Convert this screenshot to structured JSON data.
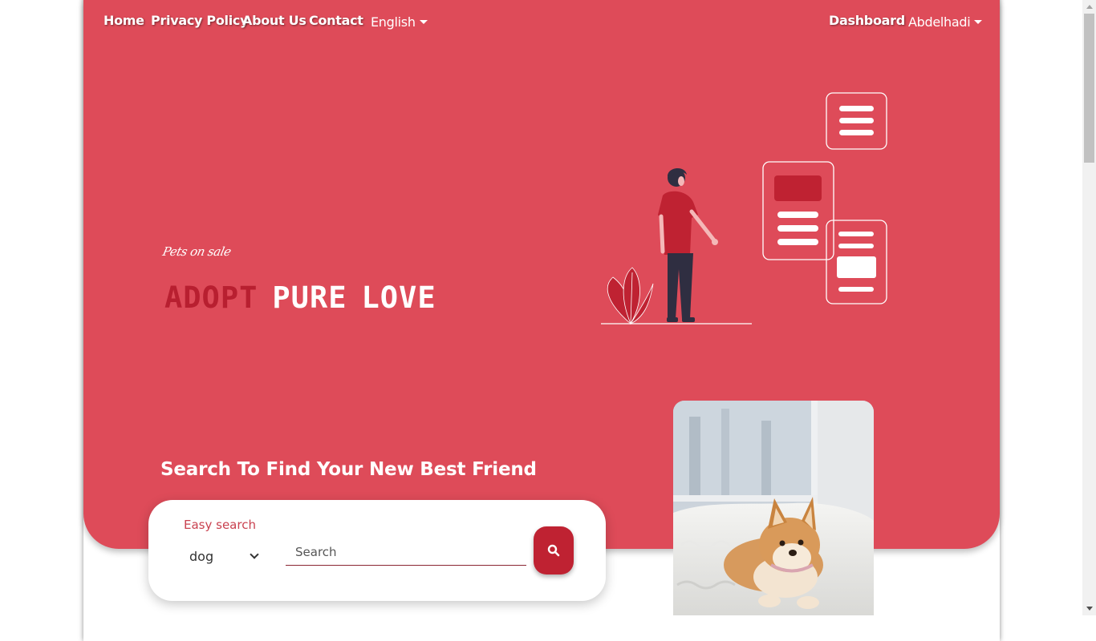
{
  "nav": {
    "left_links": [
      "Home",
      "Privacy Policy",
      "About Us",
      "Contact"
    ],
    "language": "English",
    "dashboard": "Dashboard",
    "user": "Abdelhadi"
  },
  "hero": {
    "tagline": "Pets on sale",
    "headline": [
      "ADOPT",
      "PURE",
      "LOVE"
    ],
    "search_heading": "Search To Find Your New Best Friend"
  },
  "search": {
    "label": "Easy search",
    "selected_animal": "dog",
    "placeholder": "Search"
  },
  "icons": {
    "search_button": "search-icon",
    "language_caret": "caret-down-icon",
    "user_caret": "caret-down-icon",
    "select_chevron": "chevron-down-icon"
  },
  "colors": {
    "hero_bg": "#de4b59",
    "accent_dark": "#bf2232",
    "headline_accent": "#b81f30",
    "white": "#ffffff"
  }
}
